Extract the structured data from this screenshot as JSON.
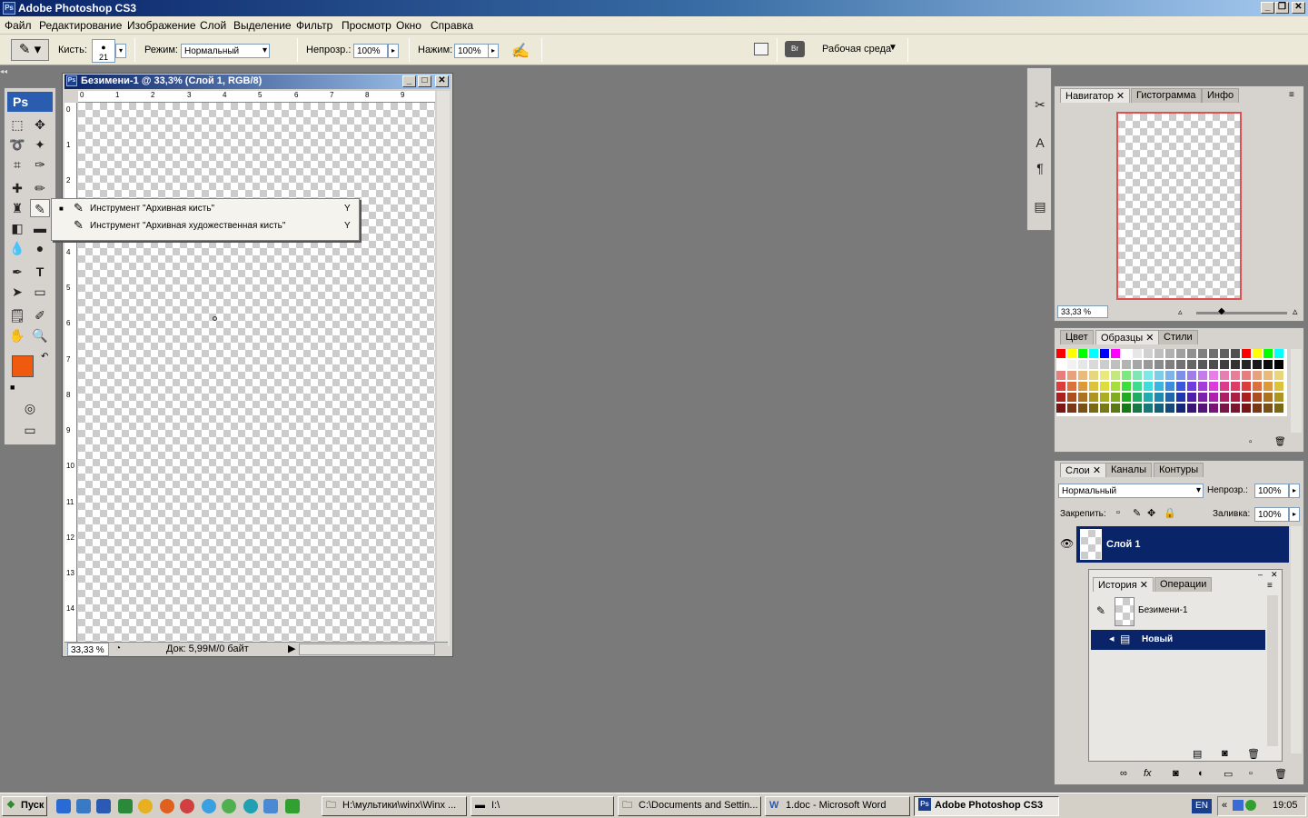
{
  "app": {
    "title": "Adobe Photoshop CS3"
  },
  "menu": [
    "Файл",
    "Редактирование",
    "Изображение",
    "Слой",
    "Выделение",
    "Фильтр",
    "Просмотр",
    "Окно",
    "Справка"
  ],
  "options": {
    "brush_label": "Кисть:",
    "brush_size": "21",
    "mode_label": "Режим:",
    "mode_value": "Нормальный",
    "opacity_label": "Непрозр.:",
    "opacity_value": "100%",
    "flow_label": "Нажим:",
    "flow_value": "100%",
    "workspace": "Рабочая среда"
  },
  "document": {
    "title": "Безимени-1 @ 33,3% (Слой 1, RGB/8)",
    "zoom": "33,33 %",
    "doc_info": "Док: 5,99M/0 байт",
    "ruler_h": [
      "0",
      "1",
      "2",
      "3",
      "4",
      "5",
      "6",
      "7",
      "8",
      "9"
    ],
    "ruler_v": [
      "0",
      "1",
      "2",
      "3",
      "4",
      "5",
      "6",
      "7",
      "8",
      "9",
      "10",
      "11",
      "12",
      "13",
      "14"
    ]
  },
  "flyout": {
    "items": [
      {
        "label": "Инструмент \"Архивная кисть\"",
        "key": "Y"
      },
      {
        "label": "Инструмент \"Архивная художественная кисть\"",
        "key": "Y"
      }
    ]
  },
  "navigator": {
    "tabs": [
      "Навигатор",
      "Гистограмма",
      "Инфо"
    ],
    "zoom": "33,33 %"
  },
  "swatches": {
    "tabs": [
      "Цвет",
      "Образцы",
      "Стили"
    ]
  },
  "layers": {
    "tabs": [
      "Слои",
      "Каналы",
      "Контуры"
    ],
    "blend_mode": "Нормальный",
    "opacity_label": "Непрозр.:",
    "opacity_value": "100%",
    "lock_label": "Закрепить:",
    "fill_label": "Заливка:",
    "fill_value": "100%",
    "layer_name": "Слой 1"
  },
  "history": {
    "tabs": [
      "История",
      "Операции"
    ],
    "snapshot": "Безимени-1",
    "step": "Новый"
  },
  "colors": {
    "foreground": "#f05a0e",
    "background": "#ffffff",
    "selection": "#0a246a"
  },
  "taskbar": {
    "start": "Пуск",
    "items": [
      "H:\\мультики\\winx\\Winx ...",
      "I:\\",
      "C:\\Documents and Settin...",
      "1.doc - Microsoft Word",
      "Adobe Photoshop CS3"
    ],
    "lang": "EN",
    "time": "19:05"
  }
}
